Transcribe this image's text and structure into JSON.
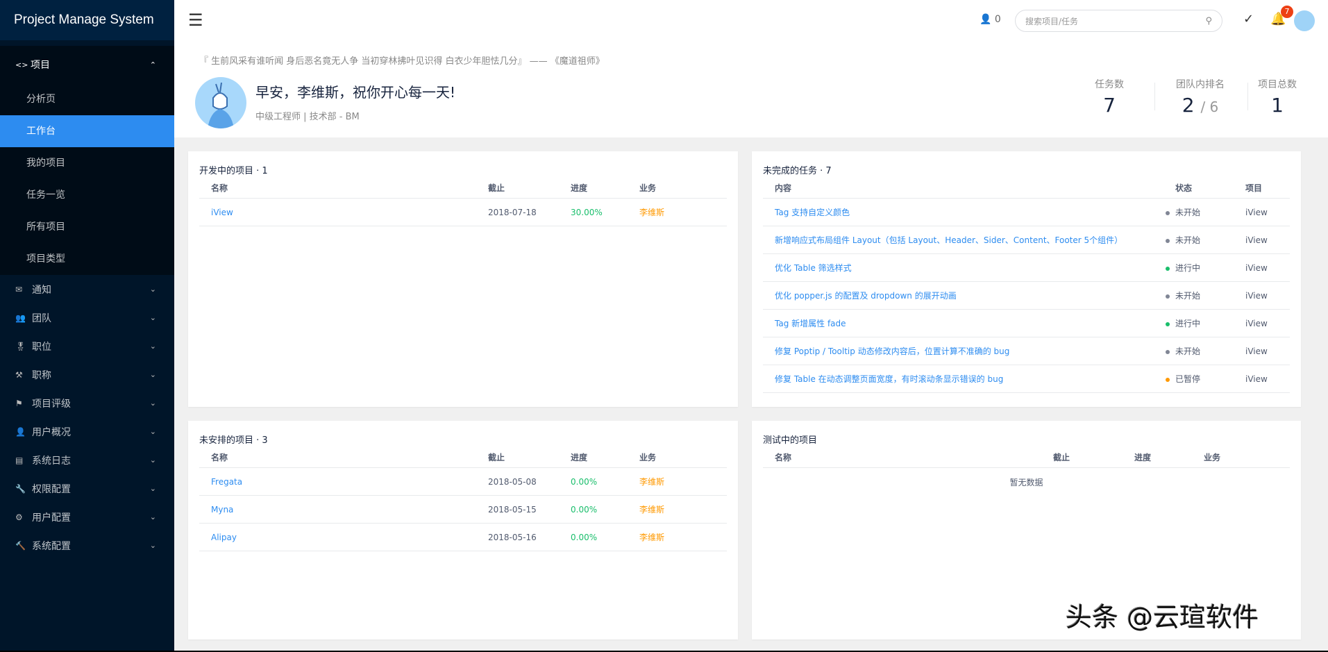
{
  "app": {
    "title": "Project Manage System"
  },
  "sidebar": {
    "open_group": {
      "label": "项目",
      "icon": "code-icon",
      "items": [
        {
          "label": "分析页"
        },
        {
          "label": "工作台",
          "active": true
        },
        {
          "label": "我的项目"
        },
        {
          "label": "任务一览"
        },
        {
          "label": "所有项目"
        },
        {
          "label": "项目类型"
        }
      ]
    },
    "items": [
      {
        "label": "通知",
        "icon": "mail-icon"
      },
      {
        "label": "团队",
        "icon": "team-icon"
      },
      {
        "label": "职位",
        "icon": "badge-icon"
      },
      {
        "label": "职称",
        "icon": "tools-icon"
      },
      {
        "label": "项目评级",
        "icon": "flag-icon"
      },
      {
        "label": "用户概况",
        "icon": "user-icon"
      },
      {
        "label": "系统日志",
        "icon": "log-icon"
      },
      {
        "label": "权限配置",
        "icon": "wrench-icon"
      },
      {
        "label": "用户配置",
        "icon": "gear-icon"
      },
      {
        "label": "系统配置",
        "icon": "hammer-icon"
      }
    ]
  },
  "header": {
    "online_count": "0",
    "search_placeholder": "搜索项目/任务",
    "notification_count": "7"
  },
  "profile": {
    "quote": "『 生前风采有谁听闻 身后恶名竟无人争 当初穿林拂叶见识得 白衣少年胆怯几分』 —— 《魔道祖师》",
    "greeting": "早安，李维斯，祝你开心每一天!",
    "role": "中级工程师 | 技术部 - BM",
    "stats": [
      {
        "label": "任务数",
        "value": "7"
      },
      {
        "label": "团队内排名",
        "value": "2",
        "suffix": "/ 6"
      },
      {
        "label": "项目总数",
        "value": "1"
      }
    ]
  },
  "project_columns": [
    "名称",
    "截止",
    "进度",
    "业务"
  ],
  "dev_projects": {
    "title": "开发中的项目 · 1",
    "rows": [
      {
        "name": "iView",
        "deadline": "2018-07-18",
        "progress": "30.00%",
        "owner": "李维斯"
      }
    ]
  },
  "unscheduled_projects": {
    "title": "未安排的项目 · 3",
    "rows": [
      {
        "name": "Fregata",
        "deadline": "2018-05-08",
        "progress": "0.00%",
        "owner": "李维斯"
      },
      {
        "name": "Myna",
        "deadline": "2018-05-15",
        "progress": "0.00%",
        "owner": "李维斯"
      },
      {
        "name": "Alipay",
        "deadline": "2018-05-16",
        "progress": "0.00%",
        "owner": "李维斯"
      }
    ]
  },
  "tasks": {
    "title": "未完成的任务 · 7",
    "columns": [
      "内容",
      "状态",
      "项目"
    ],
    "rows": [
      {
        "content": "Tag 支持自定义颜色",
        "status": "未开始",
        "status_color": "#808695",
        "project": "iView"
      },
      {
        "content": "新增响应式布局组件 Layout（包括 Layout、Header、Sider、Content、Footer 5个组件）",
        "status": "未开始",
        "status_color": "#808695",
        "project": "iView"
      },
      {
        "content": "优化 Table 筛选样式",
        "status": "进行中",
        "status_color": "#19be6b",
        "project": "iView"
      },
      {
        "content": "优化 popper.js 的配置及 dropdown 的展开动画",
        "status": "未开始",
        "status_color": "#808695",
        "project": "iView"
      },
      {
        "content": "Tag 新增属性 fade",
        "status": "进行中",
        "status_color": "#19be6b",
        "project": "iView"
      },
      {
        "content": "修复 Poptip / Tooltip 动态修改内容后，位置计算不准确的 bug",
        "status": "未开始",
        "status_color": "#808695",
        "project": "iView"
      },
      {
        "content": "修复 Table 在动态调整页面宽度，有时滚动条显示错误的 bug",
        "status": "已暂停",
        "status_color": "#ff9900",
        "project": "iView"
      }
    ]
  },
  "testing_projects": {
    "title": "测试中的项目",
    "empty_text": "暂无数据"
  },
  "watermark": "头条 @云瑄软件"
}
